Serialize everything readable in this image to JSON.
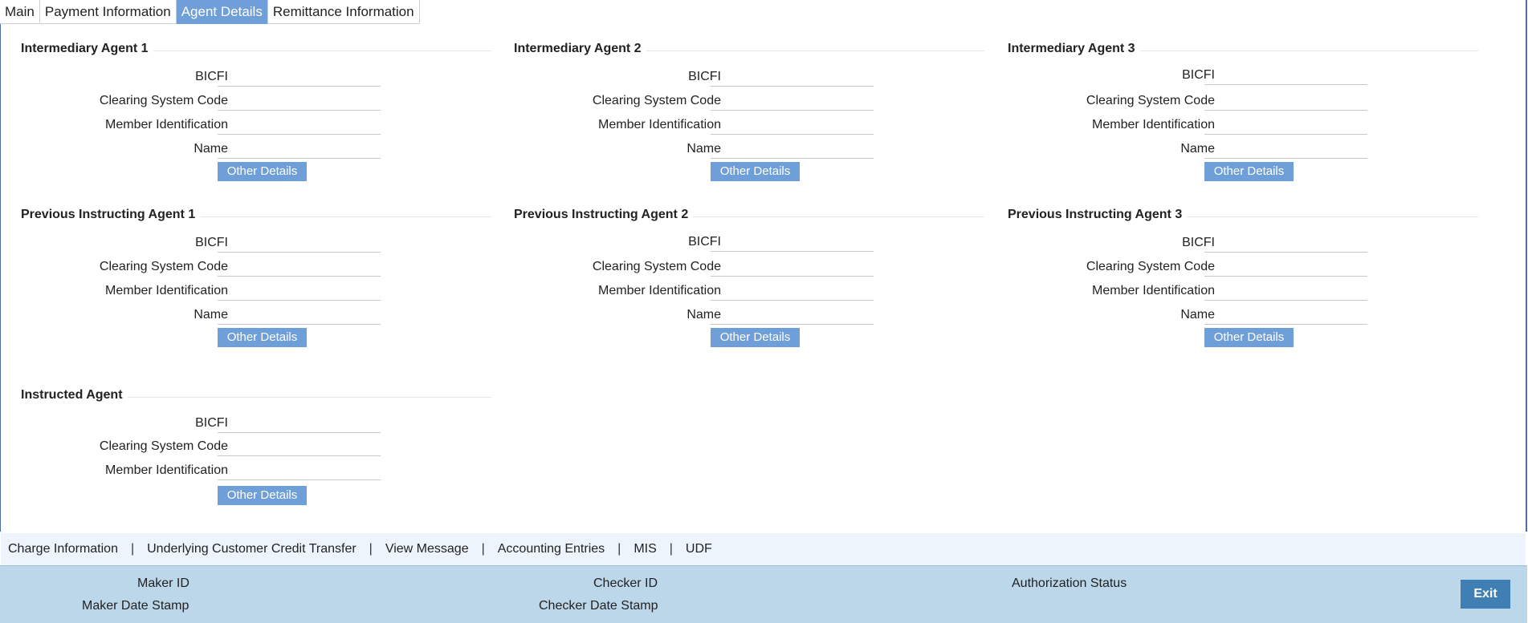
{
  "tabs": [
    {
      "label": "Main"
    },
    {
      "label": "Payment Information"
    },
    {
      "label": "Agent Details"
    },
    {
      "label": "Remittance Information"
    }
  ],
  "fields": {
    "bicfi": "BICFI",
    "clearing_system_code": "Clearing System Code",
    "member_identification": "Member Identification",
    "name": "Name"
  },
  "other_details_label": "Other Details",
  "sections": {
    "intermediary_agent_1": {
      "title": "Intermediary Agent 1"
    },
    "intermediary_agent_2": {
      "title": "Intermediary Agent 2"
    },
    "intermediary_agent_3": {
      "title": "Intermediary Agent 3"
    },
    "previous_instructing_agent_1": {
      "title": "Previous Instructing Agent 1"
    },
    "previous_instructing_agent_2": {
      "title": "Previous Instructing Agent 2"
    },
    "previous_instructing_agent_3": {
      "title": "Previous Instructing Agent 3"
    },
    "instructed_agent": {
      "title": "Instructed Agent"
    }
  },
  "footer_links": {
    "charge_information": "Charge Information",
    "underlying_customer_credit_transfer": "Underlying Customer Credit Transfer",
    "view_message": "View Message",
    "accounting_entries": "Accounting Entries",
    "mis": "MIS",
    "udf": "UDF",
    "separator": "|"
  },
  "audit": {
    "maker_id": "Maker ID",
    "maker_date_stamp": "Maker Date Stamp",
    "checker_id": "Checker ID",
    "checker_date_stamp": "Checker Date Stamp",
    "authorization_status": "Authorization Status"
  },
  "exit_label": "Exit",
  "colors": {
    "active_tab": "#6f9fd8",
    "button": "#6f9fd8",
    "audit_bar": "#bcd6ea",
    "exit_button": "#3f7fb3",
    "link_bar": "#eef4fb"
  }
}
